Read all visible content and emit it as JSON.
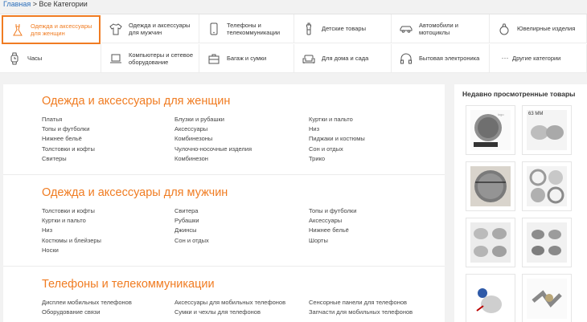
{
  "breadcrumb": {
    "home": "Главная",
    "separator": " > ",
    "current": "Все Категории"
  },
  "categories": [
    {
      "label": "Одежда и аксессуары для женщин",
      "icon": "dress-icon"
    },
    {
      "label": "Одежда и аксессуары для мужчин",
      "icon": "tshirt-icon"
    },
    {
      "label": "Телефоны и телекоммуникации",
      "icon": "phone-icon"
    },
    {
      "label": "Детские товары",
      "icon": "baby-bottle-icon"
    },
    {
      "label": "Автомобили и мотоциклы",
      "icon": "car-icon"
    },
    {
      "label": "Ювелирные изделия",
      "icon": "ring-icon"
    },
    {
      "label": "Часы",
      "icon": "watch-icon"
    },
    {
      "label": "Компьютеры и сетевое оборудование",
      "icon": "laptop-icon"
    },
    {
      "label": "Багаж и сумки",
      "icon": "bag-icon"
    },
    {
      "label": "Для дома и сада",
      "icon": "sofa-icon"
    },
    {
      "label": "Бытовая электроника",
      "icon": "headphones-icon"
    },
    {
      "label": "Другие категории",
      "icon": "dots-icon"
    }
  ],
  "sections": [
    {
      "title": "Одежда и аксессуары для женщин",
      "columns": [
        [
          "Платья",
          "Топы и футболки",
          "Нижнее бельё",
          "Толстовки и кофты",
          "Свитеры"
        ],
        [
          "Блузки и рубашки",
          "Аксессуары",
          "Комбинезоны",
          "Чулочно-носочные изделия",
          "Комбинезон"
        ],
        [
          "Куртки и пальто",
          "Низ",
          "Пиджаки и костюмы",
          "Сон и отдых",
          "Трико"
        ]
      ]
    },
    {
      "title": "Одежда и аксессуары для мужчин",
      "columns": [
        [
          "Толстовки и кофты",
          "Куртки и пальто",
          "Низ",
          "Костюмы и блейзеры",
          "Носки"
        ],
        [
          "Свитера",
          "Рубашки",
          "Джинсы",
          "Сон и отдых"
        ],
        [
          "Топы и футболки",
          "Аксессуары",
          "Нижнее бельё",
          "Шорты"
        ]
      ]
    },
    {
      "title": "Телефоны и телекоммуникации",
      "columns": [
        [
          "Дисплеи мобильных телефонов",
          "Оборудование связи"
        ],
        [
          "Аксессуары для мобильных телефонов",
          "Сумки и чехлы для телефонов"
        ],
        [
          "Сенсорные панели для телефонов",
          "Запчасти для мобильных телефонов"
        ]
      ]
    }
  ],
  "recent": {
    "title": "Недавно просмотренные товары",
    "thumb_label": "63 MM"
  },
  "colors": {
    "accent": "#f07c22",
    "link": "#2a6ebb"
  }
}
